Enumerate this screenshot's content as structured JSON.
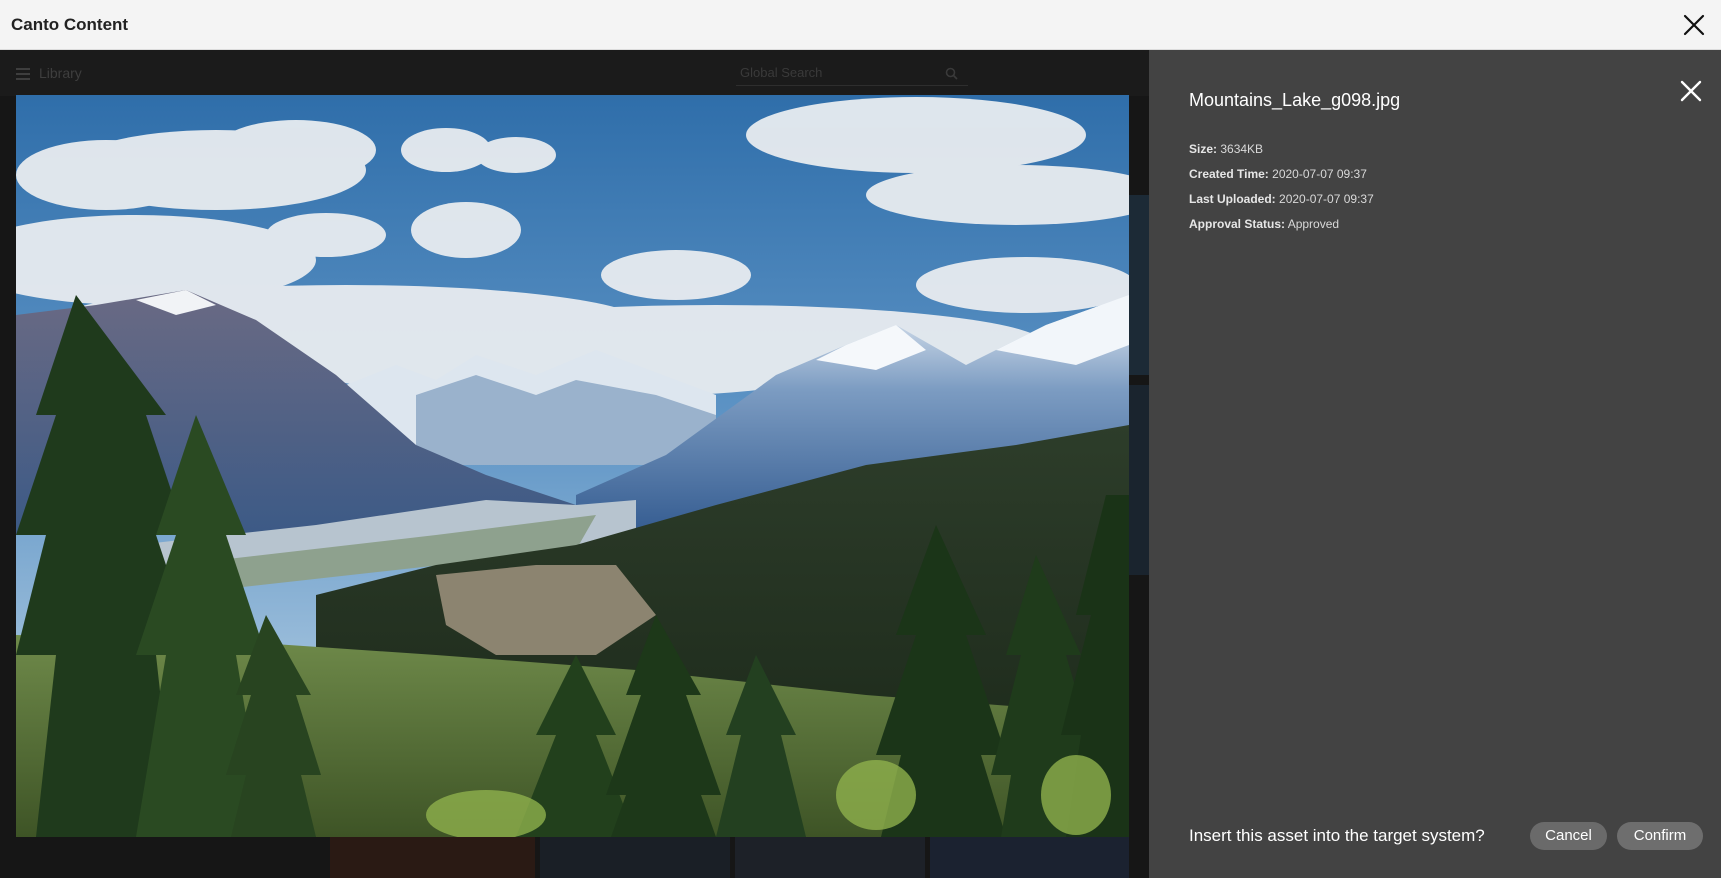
{
  "window": {
    "title": "Canto Content"
  },
  "library": {
    "label": "Library",
    "search_placeholder": "Global Search"
  },
  "asset": {
    "file_name": "Mountains_Lake_g098.jpg",
    "meta": [
      {
        "key": "Size:",
        "value": "3634KB"
      },
      {
        "key": "Created Time:",
        "value": "2020-07-07 09:37"
      },
      {
        "key": "Last Uploaded:",
        "value": "2020-07-07 09:37"
      },
      {
        "key": "Approval Status:",
        "value": "Approved"
      }
    ]
  },
  "confirm": {
    "question": "Insert this asset into the target system?",
    "cancel_label": "Cancel",
    "confirm_label": "Confirm"
  },
  "icons": {
    "window_close": "close-icon",
    "panel_close": "close-icon",
    "menu": "hamburger-icon",
    "search": "search-icon"
  },
  "colors": {
    "titlebar_bg": "#f4f4f4",
    "panel_bg": "#434343",
    "button_bg": "#6a6a6a",
    "stage_bg": "#161616"
  }
}
